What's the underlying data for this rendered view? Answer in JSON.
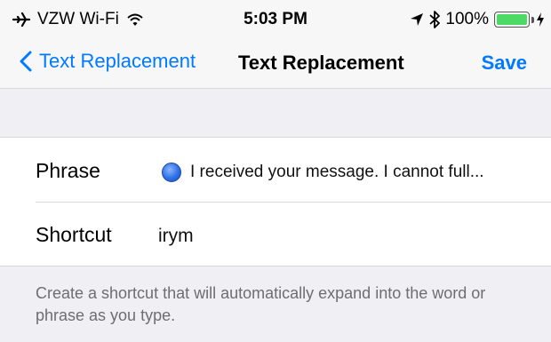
{
  "status_bar": {
    "carrier": "VZW Wi-Fi",
    "time": "5:03 PM",
    "battery_percent": "100%",
    "battery_level": 1.0,
    "icons": [
      "airplane-icon",
      "wifi-icon",
      "location-arrow-icon",
      "bluetooth-icon",
      "battery-icon",
      "charging-bolt-icon"
    ]
  },
  "nav": {
    "back_label": "Text Replacement",
    "title": "Text Replacement",
    "save_label": "Save",
    "accent_color": "#007aff"
  },
  "form": {
    "phrase_label": "Phrase",
    "phrase_value": "I received your message. I cannot full...",
    "shortcut_label": "Shortcut",
    "shortcut_value": "irym"
  },
  "footnote": "Create a shortcut that will automatically expand into the word or phrase as you type."
}
